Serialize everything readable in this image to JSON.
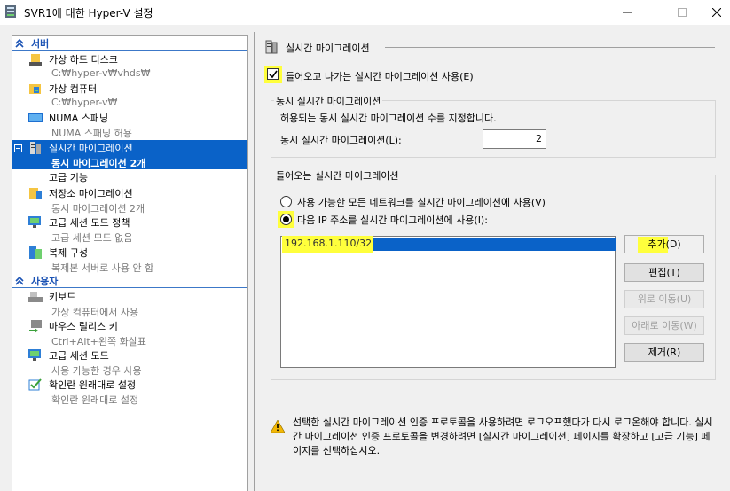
{
  "window": {
    "title": "SVR1에 대한 Hyper-V 설정",
    "min_glyph": "—",
    "max_glyph": "☐",
    "close_glyph": "✕"
  },
  "sidebar": {
    "server_header": "서버",
    "user_header": "사용자",
    "server_items": [
      {
        "label": "가상 하드 디스크",
        "sub": "C:₩hyper-v₩vhds₩",
        "icon": "disk-icon"
      },
      {
        "label": "가상 컴퓨터",
        "sub": "C:₩hyper-v₩",
        "icon": "folder-vm-icon"
      },
      {
        "label": "NUMA 스패닝",
        "sub": "NUMA 스패닝 허용",
        "icon": "monitor-icon"
      },
      {
        "label": "실시간 마이그레이션",
        "sub": "동시 마이그레이션 2개",
        "icon": "server-migration-icon",
        "selected": true
      },
      {
        "label": "고급 기능",
        "sub": "",
        "icon": ""
      },
      {
        "label": "저장소 마이그레이션",
        "sub": "동시 마이그레이션 2개",
        "icon": "storage-migration-icon"
      },
      {
        "label": "고급 세션 모드 정책",
        "sub": "고급 세션 모드 없음",
        "icon": "session-policy-icon"
      },
      {
        "label": "복제 구성",
        "sub": "복제본 서버로 사용 안 함",
        "icon": "replication-icon"
      }
    ],
    "user_items": [
      {
        "label": "키보드",
        "sub": "가상 컴퓨터에서 사용",
        "icon": "keyboard-icon"
      },
      {
        "label": "마우스 릴리스 키",
        "sub": "Ctrl+Alt+왼쪽 화살표",
        "icon": "mouse-release-icon"
      },
      {
        "label": "고급 세션 모드",
        "sub": "사용 가능한 경우 사용",
        "icon": "session-icon"
      },
      {
        "label": "확인란 원래대로 설정",
        "sub": "확인란 원래대로 설정",
        "icon": "checkbox-reset-icon"
      }
    ]
  },
  "main": {
    "section_title": "실시간 마이그레이션",
    "enable_checkbox": {
      "label": "들어오고 나가는 실시간 마이그레이션 사용(E)",
      "checked": true
    },
    "simultaneous": {
      "group_title": "동시 실시간 마이그레이션",
      "description": "허용되는 동시 실시간 마이그레이션 수를 지정합니다.",
      "field_label": "동시 실시간 마이그레이션(L):",
      "value": "2"
    },
    "incoming": {
      "group_title": "들어오는 실시간 마이그레이션",
      "radio_any": "사용 가능한 모든 네트워크를 실시간 마이그레이션에 사용(V)",
      "radio_ip": "다음 IP 주소를 실시간 마이그레이션에 사용(I):",
      "selected": "ip",
      "ip_list": [
        "192.168.1.110/32"
      ],
      "buttons": {
        "add": "추가(D)",
        "edit": "편집(T)",
        "up": "위로 이동(U)",
        "down": "아래로 이동(W)",
        "remove": "제거(R)"
      }
    },
    "warning": "선택한 실시간 마이그레이션 인증 프로토콜을 사용하려면 로그오프했다가 다시 로그온해야 합니다. 실시간 마이그레이션 인증 프로토콜을 변경하려면 [실시간 마이그레이션] 페이지를 확장하고 [고급 기능] 페이지를 선택하십시오."
  },
  "colors": {
    "selection": "#0a62c8",
    "highlight": "#ffff3c",
    "header_blue": "#1a52b4"
  }
}
